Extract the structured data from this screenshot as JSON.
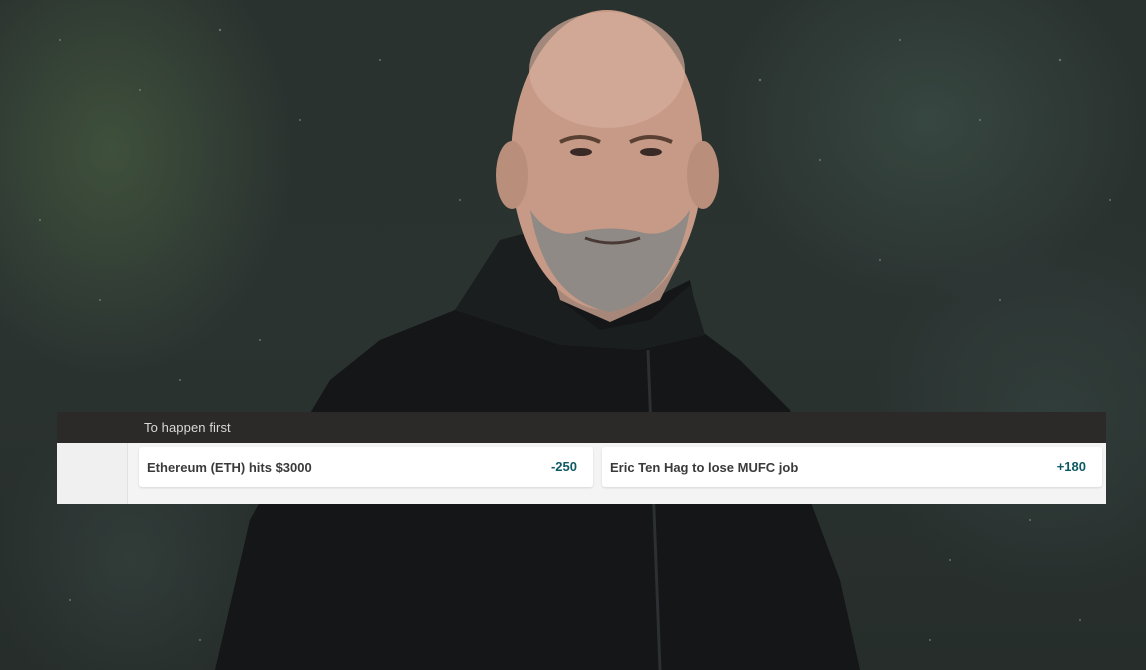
{
  "market": {
    "title": "To happen first",
    "selections": [
      {
        "label": "Ethereum (ETH) hits $3000",
        "odds": "-250"
      },
      {
        "label": "Eric Ten Hag to lose MUFC job",
        "odds": "+180"
      }
    ]
  },
  "colors": {
    "header_bg": "#2b2a29",
    "odds_text": "#0e5a63",
    "panel_bg": "#f4f4f4"
  }
}
